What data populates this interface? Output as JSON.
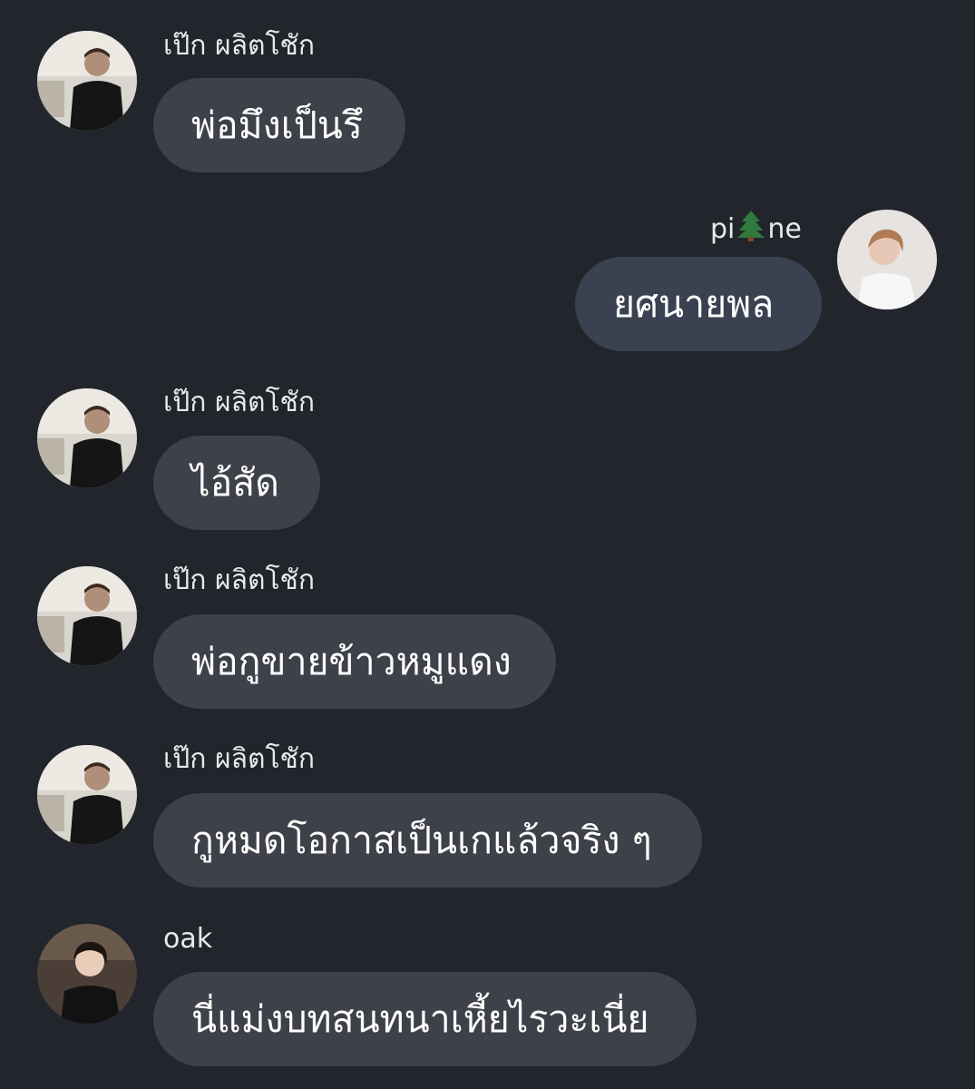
{
  "colors": {
    "background": "#23252d",
    "bubble_other": "#3e4149",
    "bubble_mine": "#3a4150",
    "sender_text": "#e8e9ec"
  },
  "messages": [
    {
      "sender": "เป๊ก ผลิตโชัก",
      "text": "พ่อมึงเป็นรึ",
      "side": "left",
      "avatar": "avatar-pek"
    },
    {
      "sender_prefix": "pi",
      "sender_emoji": "evergreen-tree-icon",
      "sender_suffix": "ne",
      "text": "ยศนายพล",
      "side": "right",
      "avatar": "avatar-pine"
    },
    {
      "sender": "เป๊ก ผลิตโชัก",
      "text": "ไอ้สัด",
      "side": "left",
      "avatar": "avatar-pek"
    },
    {
      "sender": "เป๊ก ผลิตโชัก",
      "text": "พ่อกูขายข้าวหมูแดง",
      "side": "left",
      "avatar": "avatar-pek"
    },
    {
      "sender": "เป๊ก ผลิตโชัก",
      "text": "กูหมดโอกาสเป็นเกแล้วจริง ๆ",
      "side": "left",
      "avatar": "avatar-pek"
    },
    {
      "sender": "oak",
      "text": "นี่แม่งบทสนทนาเหี้ยไรวะเนี่ย",
      "side": "left",
      "avatar": "avatar-oak"
    }
  ]
}
